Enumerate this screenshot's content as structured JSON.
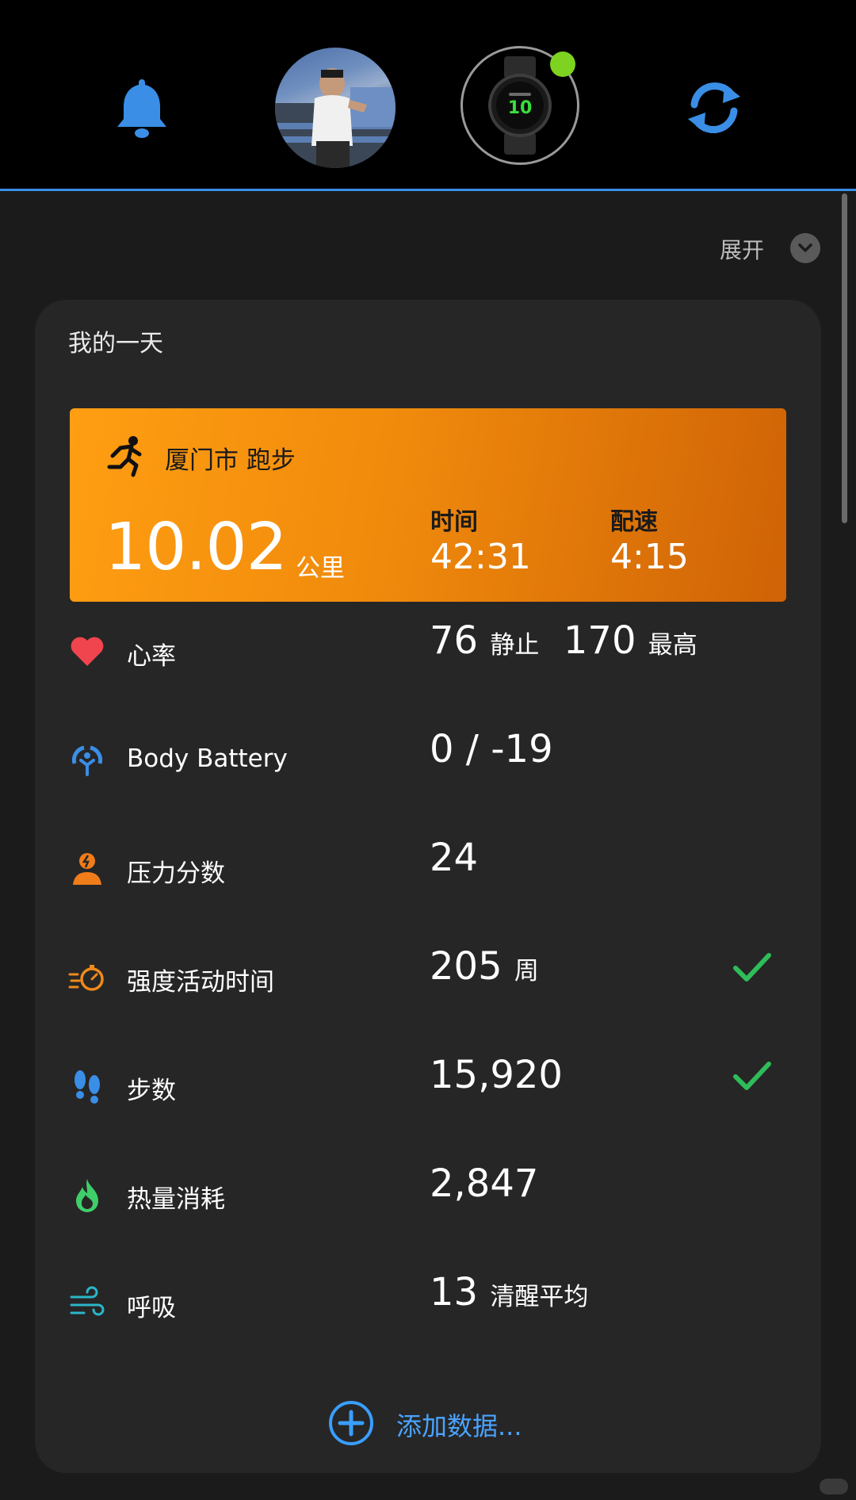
{
  "topbar": {
    "bell_icon": "bell-icon",
    "avatar": "user-avatar-photo",
    "watch_icon": "watch-icon",
    "watch_face_text": "10",
    "sync_icon": "sync-icon",
    "colors": {
      "accent": "#3a8ee6",
      "status_dot": "#7ed321"
    }
  },
  "expand": {
    "label": "展开"
  },
  "card": {
    "title": "我的一天",
    "activity": {
      "title": "厦门市 跑步",
      "distance": "10.02",
      "distance_unit": "公里",
      "time_label": "时间",
      "time_value": "42:31",
      "pace_label": "配速",
      "pace_value": "4:15",
      "icon": "running-icon",
      "color": "#f08a0c"
    },
    "metrics": [
      {
        "label": "心率",
        "icon": "heart-icon",
        "value_parts": [
          "76",
          "静止",
          "170",
          "最高"
        ],
        "checked": false
      },
      {
        "label": "Body Battery",
        "icon": "body-battery-icon",
        "value": "0 / -19",
        "checked": false
      },
      {
        "label": "压力分数",
        "icon": "stress-icon",
        "value": "24",
        "checked": false
      },
      {
        "label": "强度活动时间",
        "icon": "intensity-minutes-icon",
        "value": "205",
        "unit": "周",
        "checked": true
      },
      {
        "label": "步数",
        "icon": "steps-icon",
        "value": "15,920",
        "checked": true
      },
      {
        "label": "热量消耗",
        "icon": "calories-icon",
        "value": "2,847",
        "checked": false
      },
      {
        "label": "呼吸",
        "icon": "respiration-icon",
        "value": "13",
        "unit": "清醒平均",
        "checked": false
      }
    ],
    "add_label": "添加数据..."
  }
}
